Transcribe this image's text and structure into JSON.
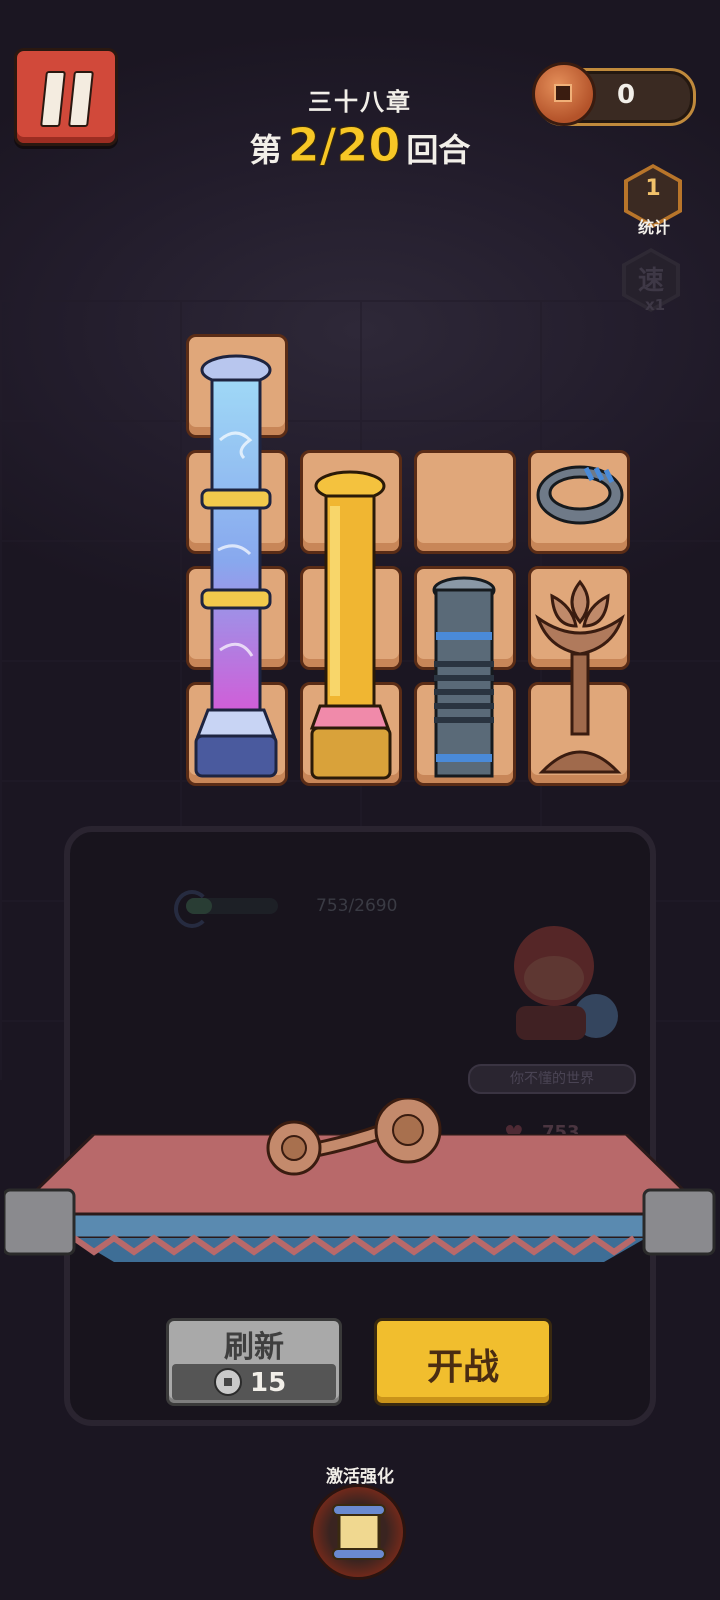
{
  "header": {
    "chapter": "三十八章",
    "round_prefix": "第",
    "round_value": "2/20",
    "round_suffix": "回合"
  },
  "currency": {
    "coins": "0",
    "icon": "copper-coin-icon"
  },
  "side_buttons": {
    "stats_label": "统计",
    "stats_glyph": "1",
    "speed_glyph": "速",
    "speed_multiplier": "x1"
  },
  "board": {
    "items": [
      {
        "name": "blue-swirl-pillar",
        "color": "#8cc8ee"
      },
      {
        "name": "golden-pillar",
        "color": "#f0b632"
      },
      {
        "name": "iron-rope-pillar",
        "color": "#5a6a78"
      },
      {
        "name": "steel-ring",
        "color": "#6f7a88"
      },
      {
        "name": "bronze-lotus-lamp",
        "color": "#b07a5c"
      }
    ]
  },
  "enemy": {
    "hp_text": "753/2690",
    "hp_fraction": 0.28,
    "name": "你不懂的世界",
    "hp": "753"
  },
  "shop_item": {
    "name": "ruyi-scepter",
    "color": "#c48a6c"
  },
  "actions": {
    "refresh_label": "刷新",
    "refresh_cost": "15",
    "fight_label": "开战",
    "activate_label": "激活强化"
  },
  "colors": {
    "accent_yellow": "#f7c726",
    "pause_red": "#d1493a",
    "cell_tan": "#e0a77a"
  }
}
